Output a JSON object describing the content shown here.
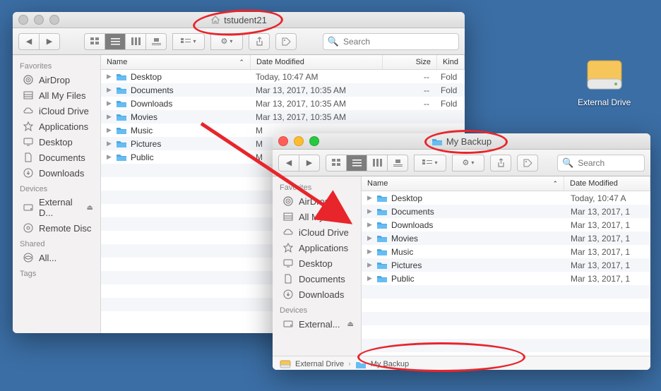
{
  "desktop": {
    "drive_label": "External Drive"
  },
  "search_placeholder": "Search",
  "sidebar": {
    "favorites_header": "Favorites",
    "devices_header": "Devices",
    "shared_header": "Shared",
    "tags_header": "Tags",
    "favorites": [
      {
        "label": "AirDrop"
      },
      {
        "label": "All My Files"
      },
      {
        "label": "iCloud Drive"
      },
      {
        "label": "Applications"
      },
      {
        "label": "Desktop"
      },
      {
        "label": "Documents"
      },
      {
        "label": "Downloads"
      }
    ],
    "devices_a": [
      {
        "label": "External D...",
        "eject": true
      },
      {
        "label": "Remote Disc"
      }
    ],
    "devices_b": [
      {
        "label": "External... ",
        "eject": true
      }
    ],
    "shared": [
      {
        "label": "All..."
      }
    ]
  },
  "columns": {
    "name": "Name",
    "date": "Date Modified",
    "size": "Size",
    "kind": "Kind"
  },
  "win1": {
    "title": "tstudent21",
    "rows": [
      {
        "name": "Desktop",
        "date": "Today, 10:47 AM",
        "size": "--",
        "kind": "Fold"
      },
      {
        "name": "Documents",
        "date": "Mar 13, 2017, 10:35 AM",
        "size": "--",
        "kind": "Fold"
      },
      {
        "name": "Downloads",
        "date": "Mar 13, 2017, 10:35 AM",
        "size": "--",
        "kind": "Fold"
      },
      {
        "name": "Movies",
        "date": "Mar 13, 2017, 10:35 AM",
        "size": "",
        "kind": ""
      },
      {
        "name": "Music",
        "date": "M",
        "size": "",
        "kind": ""
      },
      {
        "name": "Pictures",
        "date": "M",
        "size": "",
        "kind": ""
      },
      {
        "name": "Public",
        "date": "M",
        "size": "",
        "kind": ""
      }
    ]
  },
  "win2": {
    "title": "My Backup",
    "path": {
      "drive": "External Drive",
      "folder": "My Backup"
    },
    "rows": [
      {
        "name": "Desktop",
        "date": "Today, 10:47 A"
      },
      {
        "name": "Documents",
        "date": "Mar 13, 2017, 1"
      },
      {
        "name": "Downloads",
        "date": "Mar 13, 2017, 1"
      },
      {
        "name": "Movies",
        "date": "Mar 13, 2017, 1"
      },
      {
        "name": "Music",
        "date": "Mar 13, 2017, 1"
      },
      {
        "name": "Pictures",
        "date": "Mar 13, 2017, 1"
      },
      {
        "name": "Public",
        "date": "Mar 13, 2017, 1"
      }
    ]
  }
}
